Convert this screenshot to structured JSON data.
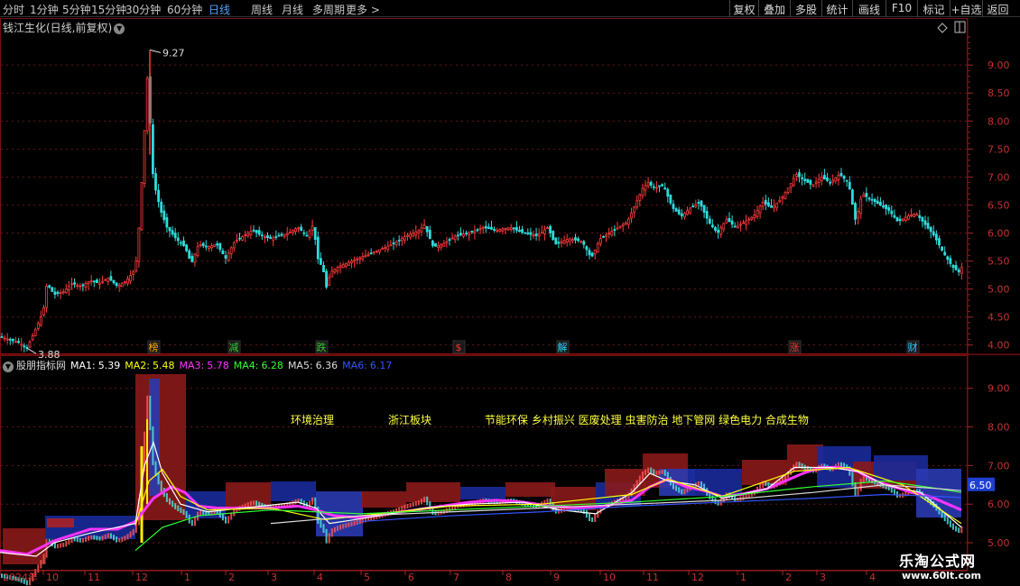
{
  "toolbar": {
    "periods": [
      "分时",
      "1分钟",
      "5分钟",
      "15分钟",
      "30分钟",
      "60分钟",
      "日线",
      "周线",
      "月线",
      "多周期",
      "更多 >"
    ],
    "active_period": "日线",
    "buttons": [
      "复权",
      "叠加",
      "多股",
      "统计",
      "画线",
      "F10",
      "标记",
      "+自选",
      "返回"
    ]
  },
  "main_panel": {
    "title": "钱江生化(日线,前复权)",
    "high_label": "9.27",
    "low_label": "3.88"
  },
  "events": [
    {
      "label": "榜",
      "color": "#ffaa00"
    },
    {
      "label": "减",
      "color": "#33cc33"
    },
    {
      "label": "跌",
      "color": "#33cc33"
    },
    {
      "label": "$",
      "color": "#ff3333"
    },
    {
      "label": "解",
      "color": "#33ccff"
    },
    {
      "label": "涨",
      "color": "#ff3333"
    },
    {
      "label": "财",
      "color": "#33ccff"
    }
  ],
  "indicator": {
    "name": "股朋指标网",
    "ma": [
      {
        "label": "MA1:",
        "value": "5.39",
        "color": "#ffffff"
      },
      {
        "label": "MA2:",
        "value": "5.48",
        "color": "#ffff00"
      },
      {
        "label": "MA3:",
        "value": "5.78",
        "color": "#ff33ff"
      },
      {
        "label": "MA4:",
        "value": "6.28",
        "color": "#33ff33"
      },
      {
        "label": "MA5:",
        "value": "6.36",
        "color": "#dddddd"
      },
      {
        "label": "MA6:",
        "value": "6.17",
        "color": "#3355ff"
      }
    ],
    "price_tag": "6.50",
    "sectors": [
      "环境治理",
      "浙江板块",
      "节能环保 乡村振兴 医废处理 虫害防治 地下管网 绿色电力 合成生物"
    ]
  },
  "watermark": {
    "line1": "乐淘公式网",
    "line2": "www.60lt.com"
  },
  "chart_data": {
    "type": "line",
    "title": "钱江生化(日线,前复权)",
    "main_axis": {
      "ticks": [
        9.0,
        8.5,
        8.0,
        7.5,
        7.0,
        6.5,
        6.0,
        5.5,
        5.0,
        4.5,
        4.0
      ],
      "ylim": [
        3.85,
        9.55
      ]
    },
    "indicator_axis": {
      "ticks": [
        9.0,
        8.0,
        7.0,
        6.0,
        5.0
      ],
      "ylim": [
        4.3,
        9.6
      ]
    },
    "x_labels": [
      "2024年",
      "10",
      "11",
      "12",
      "1",
      "2",
      "3",
      "4",
      "5",
      "6",
      "7",
      "8",
      "9",
      "10",
      "11",
      "12",
      "1",
      "2",
      "3",
      "4"
    ],
    "close_series": {
      "name": "close",
      "points": [
        [
          0,
          4.15
        ],
        [
          10,
          4.1
        ],
        [
          20,
          4.05
        ],
        [
          30,
          3.95
        ],
        [
          40,
          4.3
        ],
        [
          48,
          4.6
        ],
        [
          52,
          5.1
        ],
        [
          60,
          4.9
        ],
        [
          70,
          4.95
        ],
        [
          80,
          5.1
        ],
        [
          90,
          5.05
        ],
        [
          100,
          5.15
        ],
        [
          110,
          5.1
        ],
        [
          120,
          5.2
        ],
        [
          130,
          5.05
        ],
        [
          140,
          5.15
        ],
        [
          150,
          5.35
        ],
        [
          155,
          6.3
        ],
        [
          160,
          7.8
        ],
        [
          164,
          9.0
        ],
        [
          168,
          7.2
        ],
        [
          172,
          6.8
        ],
        [
          178,
          6.4
        ],
        [
          185,
          6.1
        ],
        [
          195,
          5.9
        ],
        [
          205,
          5.75
        ],
        [
          212,
          5.45
        ],
        [
          220,
          5.8
        ],
        [
          230,
          5.75
        ],
        [
          240,
          5.8
        ],
        [
          250,
          5.55
        ],
        [
          260,
          5.85
        ],
        [
          270,
          5.95
        ],
        [
          280,
          6.05
        ],
        [
          290,
          5.95
        ],
        [
          300,
          5.9
        ],
        [
          310,
          5.95
        ],
        [
          320,
          6.0
        ],
        [
          330,
          6.1
        ],
        [
          340,
          5.95
        ],
        [
          347,
          6.15
        ],
        [
          352,
          5.55
        ],
        [
          358,
          5.35
        ],
        [
          362,
          5.0
        ],
        [
          366,
          5.3
        ],
        [
          375,
          5.4
        ],
        [
          390,
          5.5
        ],
        [
          405,
          5.6
        ],
        [
          420,
          5.7
        ],
        [
          435,
          5.8
        ],
        [
          450,
          5.95
        ],
        [
          465,
          6.05
        ],
        [
          470,
          6.15
        ],
        [
          480,
          5.75
        ],
        [
          490,
          5.8
        ],
        [
          505,
          5.95
        ],
        [
          520,
          6.0
        ],
        [
          535,
          6.1
        ],
        [
          550,
          6.05
        ],
        [
          565,
          6.1
        ],
        [
          580,
          6.0
        ],
        [
          595,
          5.95
        ],
        [
          607,
          6.1
        ],
        [
          615,
          5.8
        ],
        [
          630,
          5.9
        ],
        [
          645,
          5.85
        ],
        [
          655,
          5.55
        ],
        [
          665,
          5.9
        ],
        [
          680,
          6.05
        ],
        [
          695,
          6.2
        ],
        [
          705,
          6.55
        ],
        [
          712,
          6.8
        ],
        [
          718,
          6.9
        ],
        [
          725,
          6.8
        ],
        [
          735,
          6.85
        ],
        [
          745,
          6.45
        ],
        [
          755,
          6.3
        ],
        [
          765,
          6.45
        ],
        [
          775,
          6.55
        ],
        [
          785,
          6.2
        ],
        [
          795,
          6.0
        ],
        [
          805,
          6.25
        ],
        [
          815,
          6.1
        ],
        [
          825,
          6.2
        ],
        [
          835,
          6.3
        ],
        [
          845,
          6.55
        ],
        [
          855,
          6.45
        ],
        [
          865,
          6.6
        ],
        [
          875,
          6.85
        ],
        [
          882,
          7.05
        ],
        [
          890,
          6.95
        ],
        [
          900,
          6.85
        ],
        [
          910,
          7.0
        ],
        [
          920,
          6.9
        ],
        [
          930,
          7.05
        ],
        [
          940,
          6.9
        ],
        [
          948,
          6.2
        ],
        [
          955,
          6.7
        ],
        [
          965,
          6.6
        ],
        [
          975,
          6.5
        ],
        [
          985,
          6.4
        ],
        [
          995,
          6.2
        ],
        [
          1005,
          6.3
        ],
        [
          1015,
          6.35
        ],
        [
          1025,
          6.15
        ],
        [
          1035,
          5.95
        ],
        [
          1045,
          5.65
        ],
        [
          1055,
          5.4
        ],
        [
          1062,
          5.3
        ],
        [
          1068,
          5.45
        ]
      ]
    },
    "indicator_series": [
      {
        "name": "MA3",
        "color": "#ff33ff",
        "points": [
          [
            0,
            4.8
          ],
          [
            30,
            4.7
          ],
          [
            60,
            5.05
          ],
          [
            100,
            5.35
          ],
          [
            130,
            5.35
          ],
          [
            150,
            5.55
          ],
          [
            170,
            6.15
          ],
          [
            190,
            6.45
          ],
          [
            205,
            6.3
          ],
          [
            220,
            5.95
          ],
          [
            240,
            5.9
          ],
          [
            270,
            5.9
          ],
          [
            300,
            5.9
          ],
          [
            330,
            5.95
          ],
          [
            350,
            5.85
          ],
          [
            370,
            5.7
          ],
          [
            400,
            5.65
          ],
          [
            430,
            5.75
          ],
          [
            460,
            5.85
          ],
          [
            490,
            5.95
          ],
          [
            520,
            6.05
          ],
          [
            550,
            6.1
          ],
          [
            580,
            6.05
          ],
          [
            610,
            5.95
          ],
          [
            640,
            5.9
          ],
          [
            670,
            5.95
          ],
          [
            700,
            6.1
          ],
          [
            720,
            6.45
          ],
          [
            740,
            6.65
          ],
          [
            760,
            6.45
          ],
          [
            780,
            6.35
          ],
          [
            800,
            6.2
          ],
          [
            820,
            6.25
          ],
          [
            850,
            6.4
          ],
          [
            870,
            6.6
          ],
          [
            890,
            6.8
          ],
          [
            910,
            6.95
          ],
          [
            930,
            6.95
          ],
          [
            950,
            6.85
          ],
          [
            970,
            6.6
          ],
          [
            990,
            6.45
          ],
          [
            1010,
            6.3
          ],
          [
            1030,
            6.2
          ],
          [
            1050,
            6.0
          ],
          [
            1065,
            5.85
          ]
        ]
      },
      {
        "name": "MA1",
        "color": "#ffffff",
        "points": [
          [
            0,
            4.75
          ],
          [
            40,
            4.65
          ],
          [
            60,
            5.0
          ],
          [
            100,
            5.25
          ],
          [
            150,
            5.5
          ],
          [
            160,
            7.0
          ],
          [
            170,
            7.6
          ],
          [
            180,
            6.8
          ],
          [
            200,
            6.0
          ],
          [
            230,
            5.8
          ],
          [
            270,
            5.9
          ],
          [
            330,
            6.05
          ],
          [
            350,
            5.9
          ],
          [
            365,
            5.5
          ],
          [
            380,
            5.55
          ],
          [
            420,
            5.7
          ],
          [
            470,
            5.9
          ],
          [
            520,
            6.0
          ],
          [
            580,
            6.05
          ],
          [
            620,
            5.85
          ],
          [
            660,
            5.75
          ],
          [
            700,
            6.3
          ],
          [
            720,
            6.8
          ],
          [
            740,
            6.6
          ],
          [
            770,
            6.5
          ],
          [
            800,
            6.15
          ],
          [
            850,
            6.4
          ],
          [
            880,
            6.95
          ],
          [
            920,
            6.95
          ],
          [
            950,
            6.85
          ],
          [
            980,
            6.5
          ],
          [
            1020,
            6.3
          ],
          [
            1045,
            5.8
          ],
          [
            1065,
            5.4
          ]
        ]
      },
      {
        "name": "MA2",
        "color": "#ffff00",
        "points": [
          [
            150,
            5.45
          ],
          [
            165,
            6.6
          ],
          [
            180,
            6.9
          ],
          [
            200,
            6.2
          ],
          [
            230,
            5.85
          ],
          [
            300,
            5.9
          ],
          [
            360,
            5.6
          ],
          [
            420,
            5.75
          ],
          [
            500,
            5.95
          ],
          [
            600,
            6.0
          ],
          [
            700,
            6.25
          ],
          [
            740,
            6.65
          ],
          [
            800,
            6.2
          ],
          [
            880,
            6.85
          ],
          [
            940,
            6.95
          ],
          [
            1000,
            6.5
          ],
          [
            1065,
            5.5
          ]
        ]
      },
      {
        "name": "MA4",
        "color": "#33ff33",
        "points": [
          [
            150,
            4.8
          ],
          [
            180,
            5.4
          ],
          [
            220,
            5.7
          ],
          [
            300,
            5.85
          ],
          [
            400,
            5.75
          ],
          [
            500,
            5.85
          ],
          [
            600,
            5.95
          ],
          [
            700,
            6.05
          ],
          [
            800,
            6.2
          ],
          [
            900,
            6.45
          ],
          [
            980,
            6.6
          ],
          [
            1040,
            6.4
          ],
          [
            1065,
            6.3
          ]
        ]
      },
      {
        "name": "MA5",
        "color": "#dddddd",
        "points": [
          [
            300,
            5.5
          ],
          [
            400,
            5.7
          ],
          [
            500,
            5.8
          ],
          [
            600,
            5.9
          ],
          [
            700,
            6.0
          ],
          [
            800,
            6.1
          ],
          [
            900,
            6.3
          ],
          [
            980,
            6.5
          ],
          [
            1040,
            6.4
          ],
          [
            1065,
            6.35
          ]
        ]
      },
      {
        "name": "MA6",
        "color": "#3355ff",
        "points": [
          [
            400,
            5.55
          ],
          [
            500,
            5.7
          ],
          [
            600,
            5.8
          ],
          [
            700,
            5.95
          ],
          [
            800,
            6.05
          ],
          [
            900,
            6.15
          ],
          [
            980,
            6.25
          ],
          [
            1040,
            6.2
          ],
          [
            1065,
            6.17
          ]
        ]
      }
    ]
  }
}
